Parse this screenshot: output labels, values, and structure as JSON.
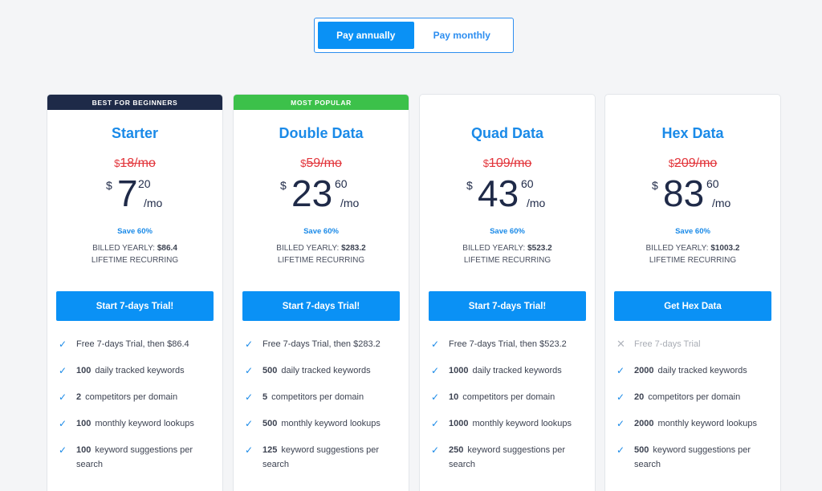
{
  "toggle": {
    "annual": "Pay annually",
    "monthly": "Pay monthly"
  },
  "colors": {
    "accent": "#0a91f5",
    "beginner_ribbon": "#1e2a48",
    "popular_ribbon": "#3cc14a",
    "strike": "#e2353b"
  },
  "plans": [
    {
      "ribbon": "BEST FOR BEGINNERS",
      "name": "Starter",
      "old_currency": "$",
      "old_amount": "18/mo",
      "currency": "$",
      "price_whole": "7",
      "price_cents": "20",
      "per": "/mo",
      "save": "Save 60%",
      "billed_label": "BILLED YEARLY:",
      "billed_amount": "$86.4",
      "recurring": "LIFETIME RECURRING",
      "cta": "Start 7-days Trial!",
      "features": [
        {
          "num": "",
          "text": "Free 7-days Trial, then $86.4"
        },
        {
          "num": "100",
          "text": "daily tracked keywords"
        },
        {
          "num": "2",
          "text": "competitors per domain"
        },
        {
          "num": "100",
          "text": "monthly keyword lookups"
        },
        {
          "num": "100",
          "text": "keyword suggestions per search"
        }
      ]
    },
    {
      "ribbon": "MOST POPULAR",
      "name": "Double Data",
      "old_currency": "$",
      "old_amount": "59/mo",
      "currency": "$",
      "price_whole": "23",
      "price_cents": "60",
      "per": "/mo",
      "save": "Save 60%",
      "billed_label": "BILLED YEARLY:",
      "billed_amount": "$283.2",
      "recurring": "LIFETIME RECURRING",
      "cta": "Start 7-days Trial!",
      "features": [
        {
          "num": "",
          "text": "Free 7-days Trial, then $283.2"
        },
        {
          "num": "500",
          "text": "daily tracked keywords"
        },
        {
          "num": "5",
          "text": "competitors per domain"
        },
        {
          "num": "500",
          "text": "monthly keyword lookups"
        },
        {
          "num": "125",
          "text": "keyword suggestions per search"
        }
      ]
    },
    {
      "ribbon": "",
      "name": "Quad Data",
      "old_currency": "$",
      "old_amount": "109/mo",
      "currency": "$",
      "price_whole": "43",
      "price_cents": "60",
      "per": "/mo",
      "save": "Save 60%",
      "billed_label": "BILLED YEARLY:",
      "billed_amount": "$523.2",
      "recurring": "LIFETIME RECURRING",
      "cta": "Start 7-days Trial!",
      "features": [
        {
          "num": "",
          "text": "Free 7-days Trial, then $523.2"
        },
        {
          "num": "1000",
          "text": "daily tracked keywords"
        },
        {
          "num": "10",
          "text": "competitors per domain"
        },
        {
          "num": "1000",
          "text": "monthly keyword lookups"
        },
        {
          "num": "250",
          "text": "keyword suggestions per search"
        }
      ]
    },
    {
      "ribbon": "",
      "name": "Hex Data",
      "old_currency": "$",
      "old_amount": "209/mo",
      "currency": "$",
      "price_whole": "83",
      "price_cents": "60",
      "per": "/mo",
      "save": "Save 60%",
      "billed_label": "BILLED YEARLY:",
      "billed_amount": "$1003.2",
      "recurring": "LIFETIME RECURRING",
      "cta": "Get Hex Data",
      "features": [
        {
          "num": "",
          "text": "Free 7-days Trial",
          "disabled": true
        },
        {
          "num": "2000",
          "text": "daily tracked keywords"
        },
        {
          "num": "20",
          "text": "competitors per domain"
        },
        {
          "num": "2000",
          "text": "monthly keyword lookups"
        },
        {
          "num": "500",
          "text": "keyword suggestions per search"
        }
      ]
    }
  ]
}
